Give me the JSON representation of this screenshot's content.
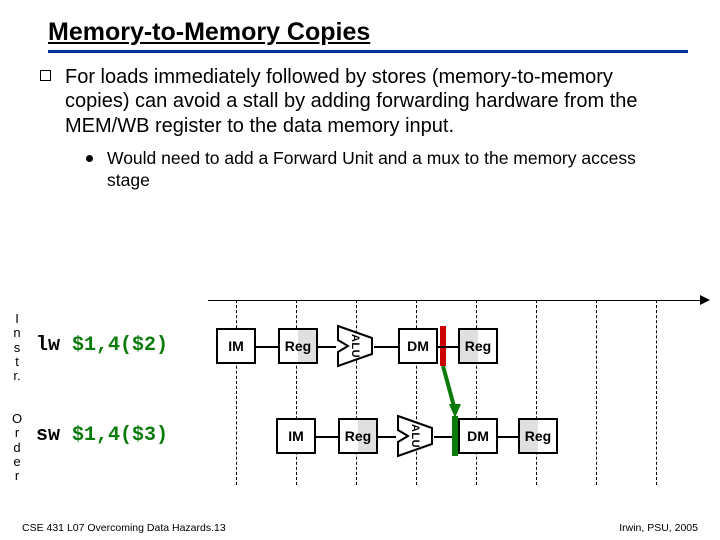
{
  "title": "Memory-to-Memory Copies",
  "bullet": "For loads immediately followed by stores (memory-to-memory copies) can avoid a stall by adding forwarding hardware from the MEM/WB register to the data memory input.",
  "sub_bullet": "Would need to add a Forward Unit and a mux to the memory access stage",
  "row1": {
    "side": "I\nn\ns\nt\nr.",
    "op": "lw",
    "args": "$1,4($2)",
    "stages": {
      "im": "IM",
      "reg1": "Reg",
      "alu": "ALU",
      "dm": "DM",
      "reg2": "Reg"
    }
  },
  "row2": {
    "side": "O\nr\nd\ne\nr",
    "op": "sw",
    "args": "$1,4($3)",
    "stages": {
      "im": "IM",
      "reg1": "Reg",
      "alu": "ALU",
      "dm": "DM",
      "reg2": "Reg"
    }
  },
  "footer_left": "CSE 431  L07 Overcoming Data Hazards.13",
  "footer_right": "Irwin, PSU, 2005"
}
